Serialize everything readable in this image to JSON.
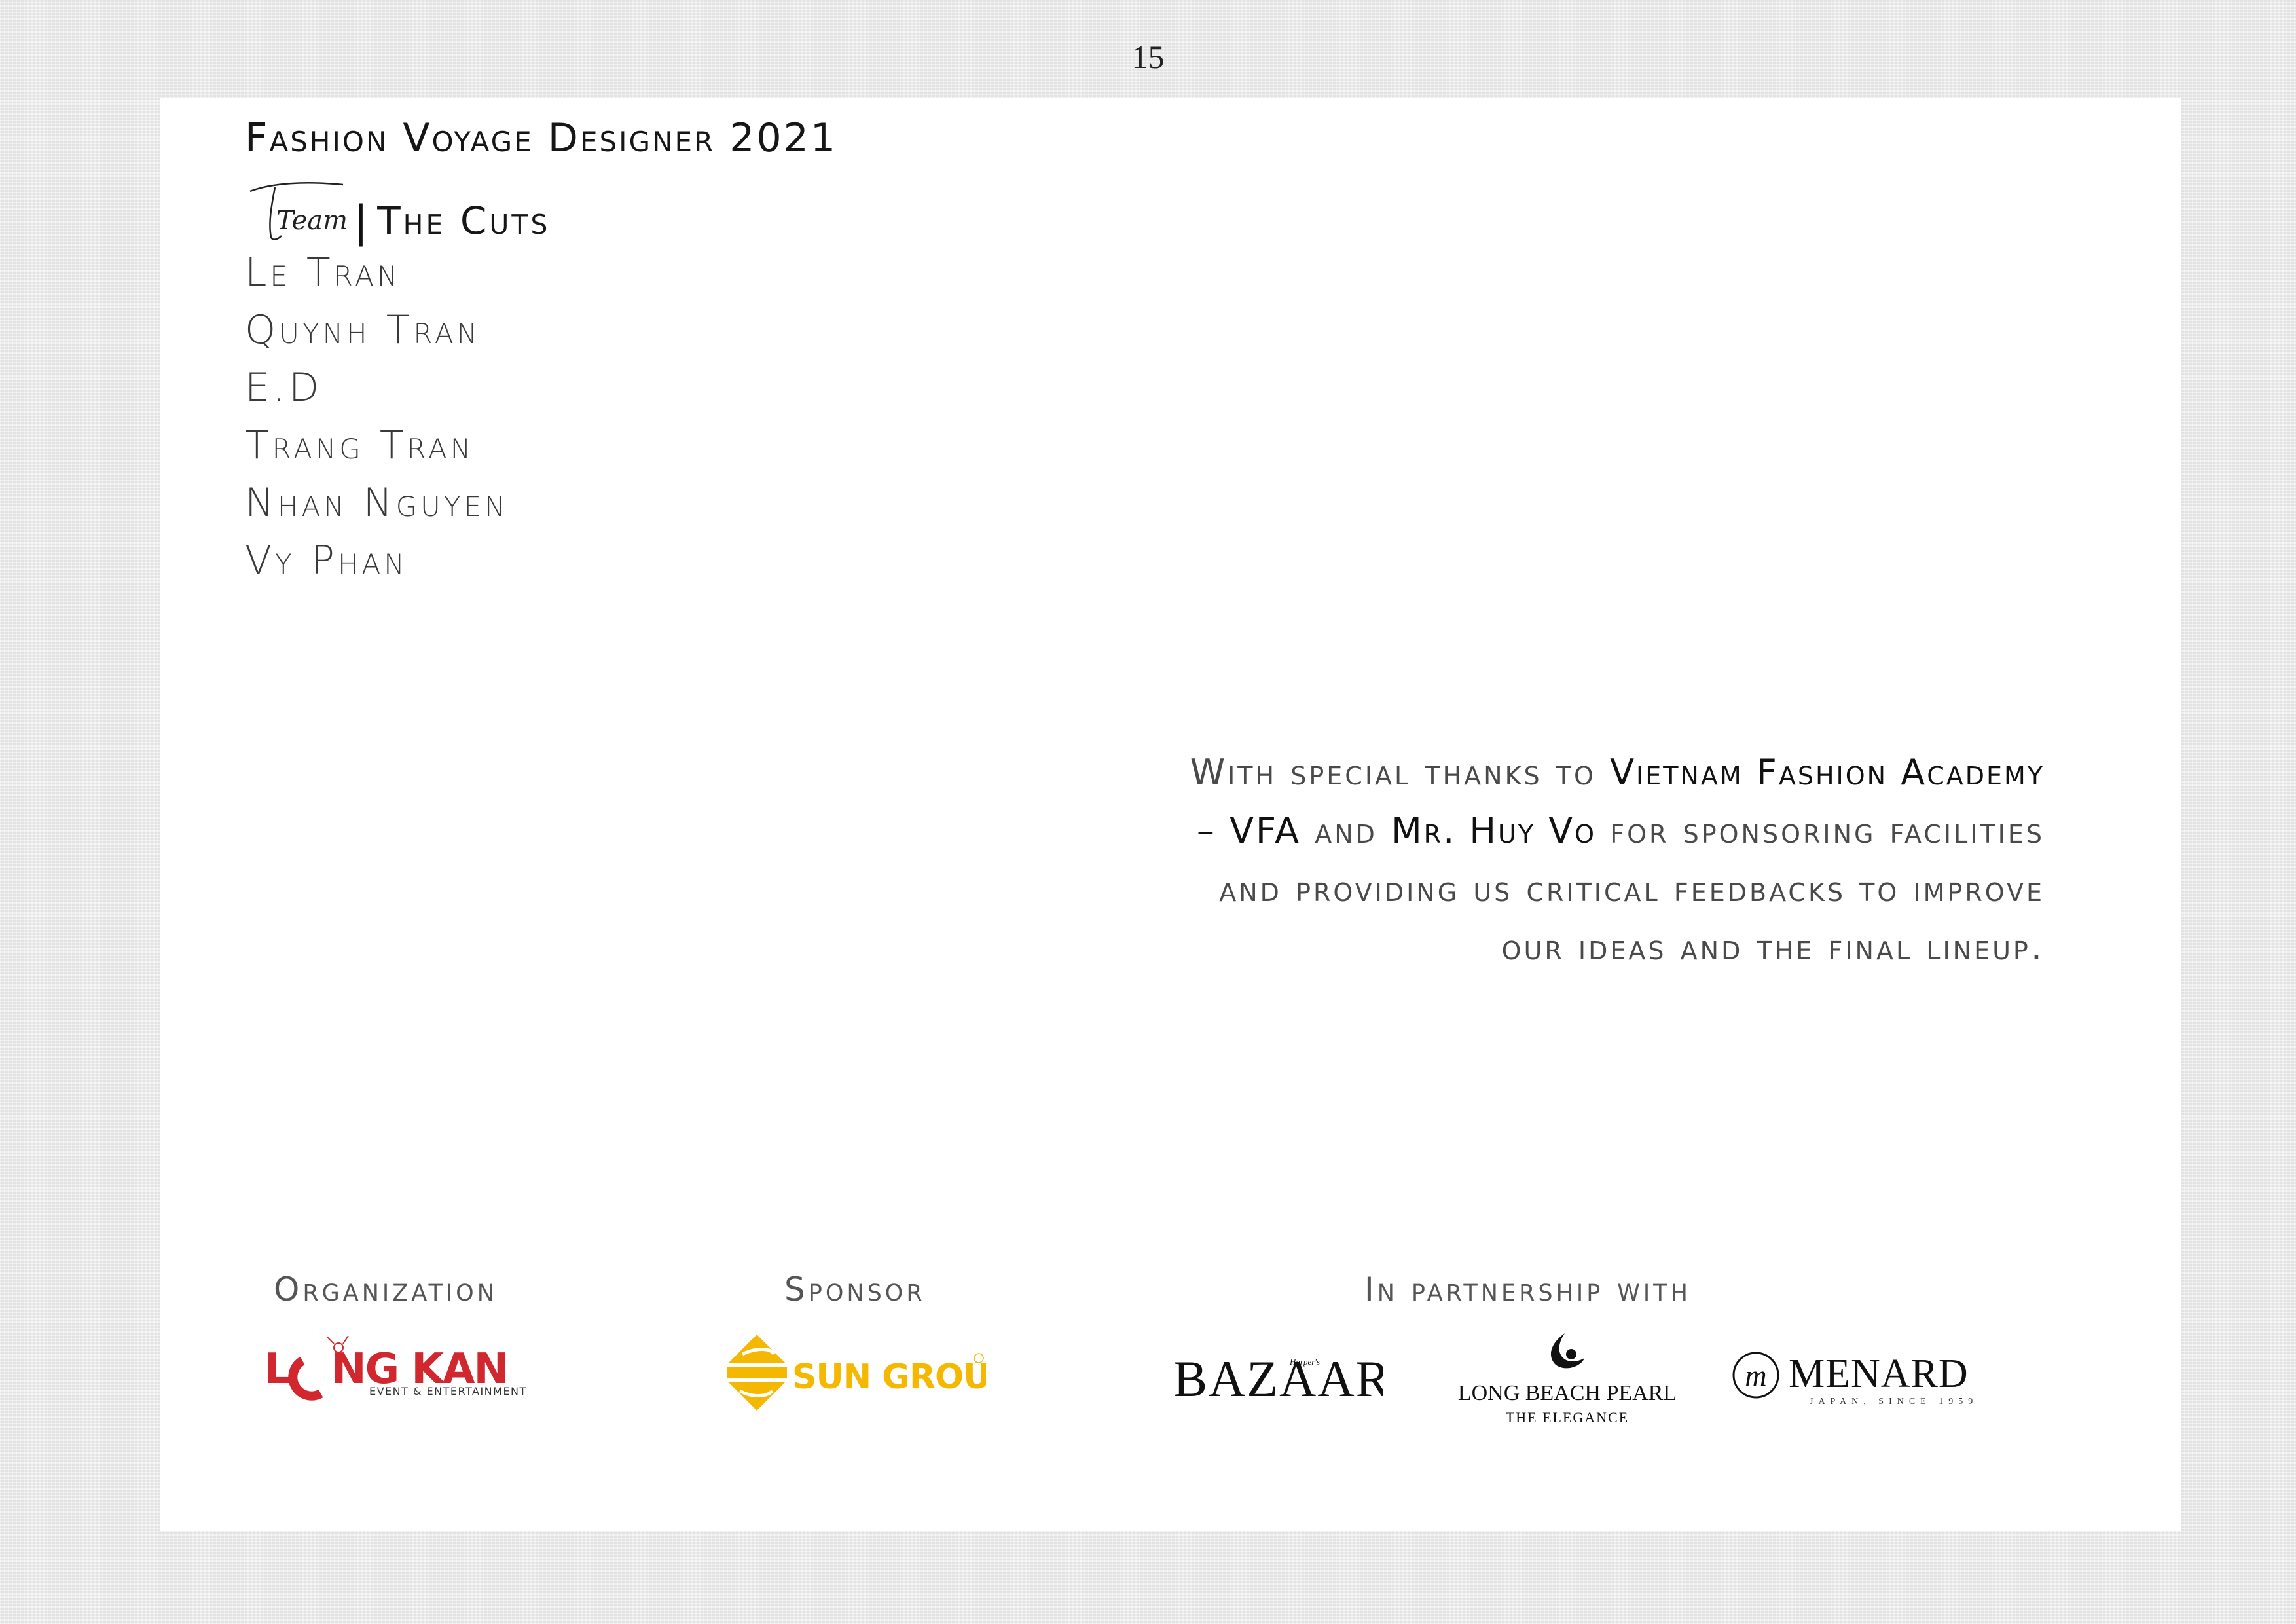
{
  "page_number": "15",
  "title": "Fashion Voyage Designer 2021",
  "team": {
    "script_label": "Team",
    "divider": "|",
    "name": "The Cuts"
  },
  "members": [
    "Le Tran",
    "Quynh Tran",
    "E.D",
    "Trang Tran",
    "Nhan Nguyen",
    "Vy Phan"
  ],
  "thanks": {
    "part1": "With special thanks to ",
    "org": "Vietnam Fashion Academy",
    "org_abbr": "– VFA",
    "part2": " and ",
    "person": "Mr. Huy Vo",
    "part3": " for sponsoring facilities",
    "line3": "and providing us critical feedbacks to improve",
    "line4": "our ideas and the final lineup."
  },
  "labels": {
    "organization": "Organization",
    "sponsor": "Sponsor",
    "partnership": "In partnership with"
  },
  "logos": {
    "longkan": {
      "name": "LONGKAN",
      "sub": "EVENT & ENTERTAINMENT",
      "color": "#d0282e"
    },
    "sungroup": {
      "name": "SUN GROUP",
      "color": "#f5b800"
    },
    "bazaar": {
      "name": "BAZAAR",
      "small": "Harper's"
    },
    "longbeach": {
      "name": "LONG BEACH PEARL",
      "sub": "THE ELEGANCE"
    },
    "menard": {
      "name": "MENARD",
      "sub": "JAPAN, SINCE 1959",
      "mark": "m"
    }
  }
}
